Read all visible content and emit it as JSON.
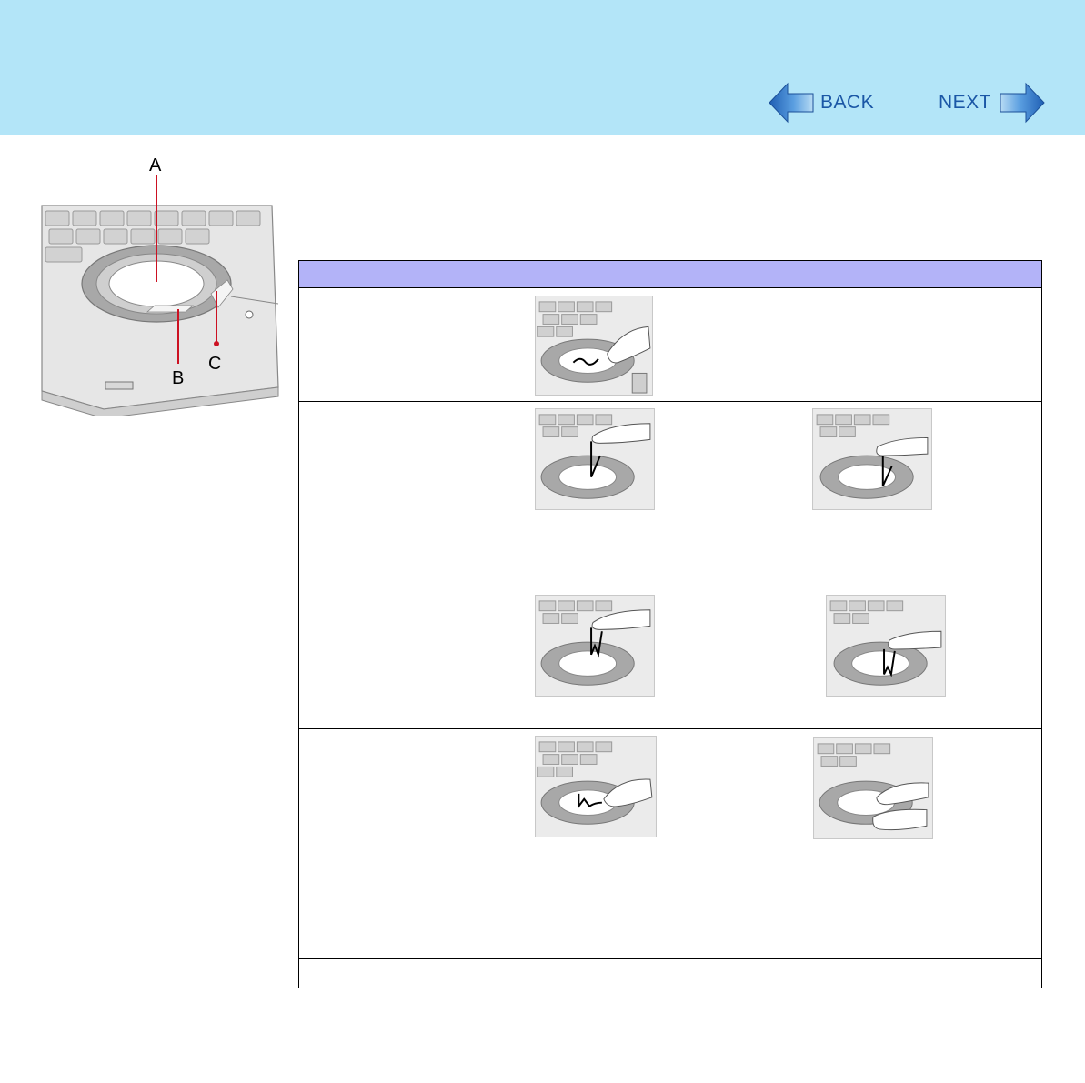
{
  "nav": {
    "back_label": "BACK",
    "next_label": "NEXT",
    "arrow_icon": "arrow-icon",
    "accent_color": "#1b57a6",
    "header_color": "#b3e5f8"
  },
  "figure": {
    "callouts": [
      "A",
      "B",
      "C"
    ],
    "line_color": "#cc1122"
  },
  "table": {
    "header_color": "#b3b3f8",
    "columns": [
      "",
      ""
    ],
    "rows": [
      {
        "left": "",
        "images": 1
      },
      {
        "left": "",
        "images": 2
      },
      {
        "left": "",
        "images": 2
      },
      {
        "left": "",
        "images": 2
      },
      {
        "left": "",
        "images": 0
      }
    ]
  }
}
